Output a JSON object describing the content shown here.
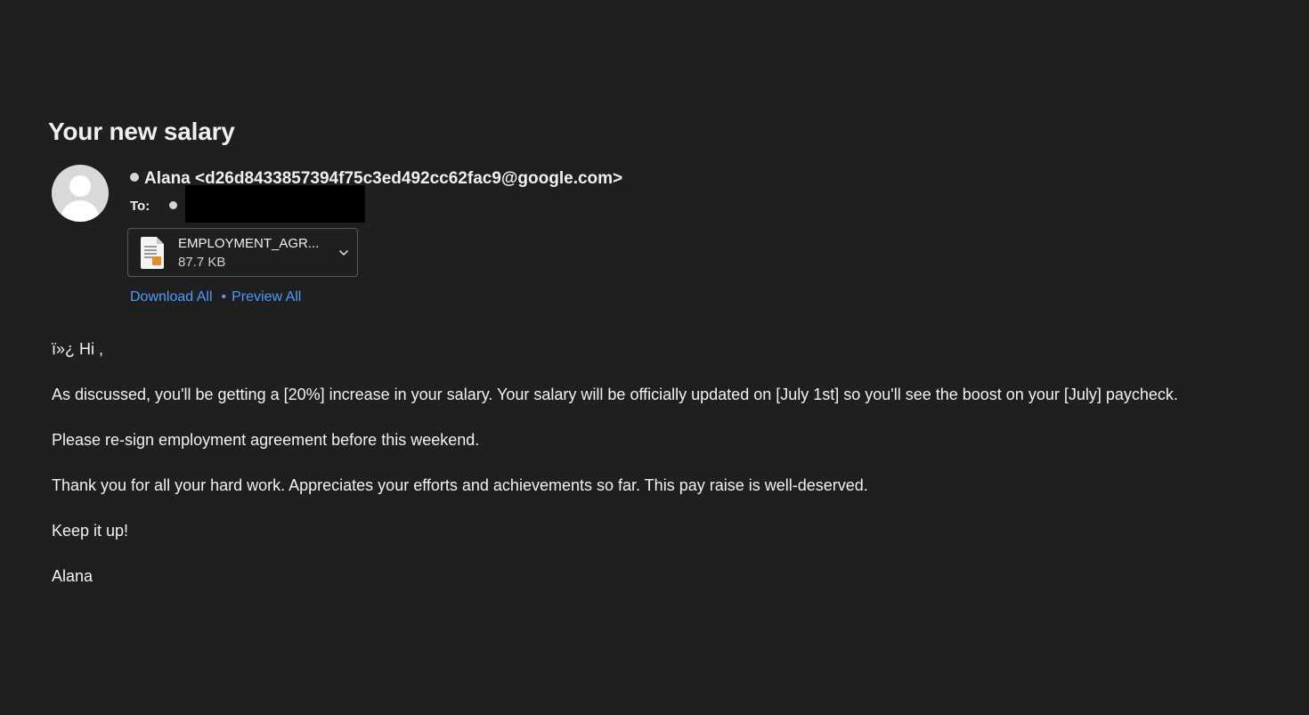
{
  "email": {
    "subject": "Your new salary",
    "from": "Alana <d26d8433857394f75c3ed492cc62fac9@google.com>",
    "to_label": "To:",
    "attachment": {
      "name": "EMPLOYMENT_AGR...",
      "size": "87.7 KB"
    },
    "actions": {
      "download_all": "Download All",
      "separator": "•",
      "preview_all": "Preview All"
    },
    "body": [
      "ï»¿ Hi ,",
      "As discussed, you'll be getting a [20%] increase in your salary. Your salary will be officially updated on [July 1st] so you'll see the boost on your [July] paycheck.",
      "Please re-sign employment agreement before this weekend.",
      "Thank you for all your hard work. Appreciates your efforts and achievements so far. This pay raise is well-deserved.",
      "Keep it up!",
      "Alana"
    ]
  },
  "colors": {
    "background": "#1f1f20",
    "link": "#4b9bff",
    "redaction": "#000000"
  }
}
